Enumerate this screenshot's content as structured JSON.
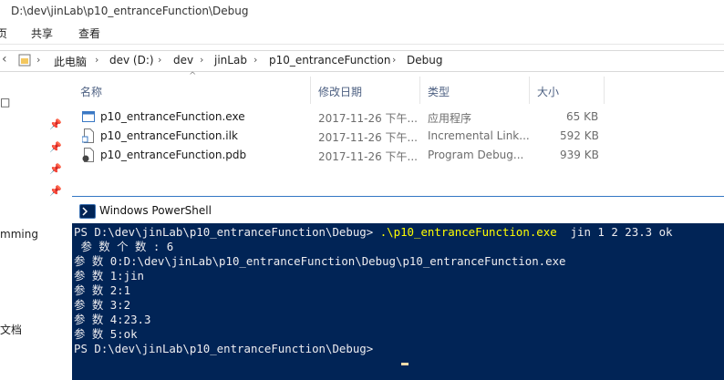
{
  "explorer": {
    "title": "D:\\dev\\jinLab\\p10_entranceFunction\\Debug",
    "tabs": [
      "页",
      "共享",
      "查看"
    ],
    "breadcrumb": [
      "此电脑",
      "dev (D:)",
      "dev",
      "jinLab",
      "p10_entranceFunction",
      "Debug"
    ],
    "columns": {
      "name": "名称",
      "date": "修改日期",
      "type": "类型",
      "size": "大小"
    },
    "files": [
      {
        "name": "p10_entranceFunction.exe",
        "date": "2017-11-26 下午...",
        "type": "应用程序",
        "size": "65 KB",
        "icon": "exe-file-icon"
      },
      {
        "name": "p10_entranceFunction.ilk",
        "date": "2017-11-26 下午...",
        "type": "Incremental Link...",
        "size": "592 KB",
        "icon": "ilk-file-icon"
      },
      {
        "name": "p10_entranceFunction.pdb",
        "date": "2017-11-26 下午...",
        "type": "Program Debug...",
        "size": "939 KB",
        "icon": "pdb-file-icon"
      }
    ],
    "nav_fragments": [
      "mming",
      "文档"
    ]
  },
  "powershell": {
    "title": "Windows PowerShell",
    "lines": [
      {
        "prompt": "PS D:\\dev\\jinLab\\p10_entranceFunction\\Debug> ",
        "command": ".\\p10_entranceFunction.exe",
        "args": "  jin 1 2 23.3 ok"
      },
      {
        "text": " 参 数 个 数 : 6"
      },
      {
        "text": "参 数 0:D:\\dev\\jinLab\\p10_entranceFunction\\Debug\\p10_entranceFunction.exe"
      },
      {
        "text": "参 数 1:jin"
      },
      {
        "text": "参 数 2:1"
      },
      {
        "text": "参 数 3:2"
      },
      {
        "text": "参 数 4:23.3"
      },
      {
        "text": "参 数 5:ok"
      },
      {
        "prompt": "PS D:\\dev\\jinLab\\p10_entranceFunction\\Debug> "
      }
    ]
  }
}
